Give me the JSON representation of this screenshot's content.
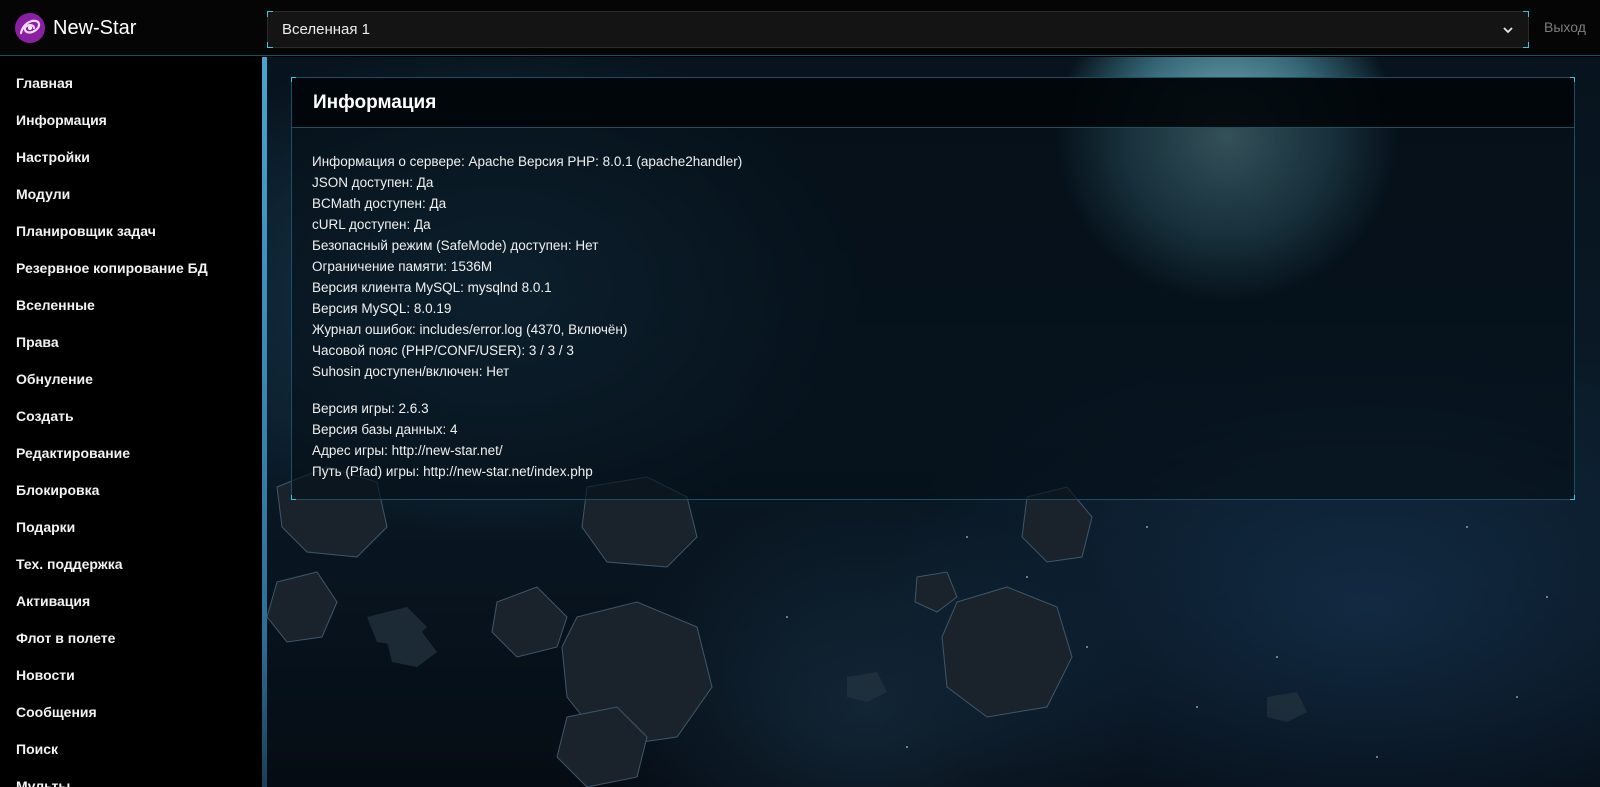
{
  "header": {
    "brand_name": "New-Star",
    "universe_select_value": "Вселенная 1",
    "logout_label": "Выход"
  },
  "sidebar": {
    "items": [
      {
        "label": "Главная"
      },
      {
        "label": "Информация"
      },
      {
        "label": "Настройки"
      },
      {
        "label": "Модули"
      },
      {
        "label": "Планировщик задач"
      },
      {
        "label": "Резервное копирование БД"
      },
      {
        "label": "Вселенные"
      },
      {
        "label": "Права"
      },
      {
        "label": "Обнуление"
      },
      {
        "label": "Создать"
      },
      {
        "label": "Редактирование"
      },
      {
        "label": "Блокировка"
      },
      {
        "label": "Подарки"
      },
      {
        "label": "Тех. поддержка"
      },
      {
        "label": "Активация"
      },
      {
        "label": "Флот в полете"
      },
      {
        "label": "Новости"
      },
      {
        "label": "Сообщения"
      },
      {
        "label": "Поиск"
      },
      {
        "label": "Мульты"
      }
    ]
  },
  "panel": {
    "title": "Информация",
    "server_info": [
      "Информация о сервере: Apache Версия PHP: 8.0.1 (apache2handler)",
      "JSON доступен: Да",
      "BCMath доступен: Да",
      "cURL доступен: Да",
      "Безопасный режим (SafeMode) доступен: Нет",
      "Ограничение памяти: 1536M",
      "Версия клиента MySQL: mysqlnd 8.0.1",
      "Версия MySQL: 8.0.19",
      "Журнал ошибок: includes/error.log (4370, Включён)",
      "Часовой пояс (PHP/CONF/USER): 3 / 3 / 3",
      "Suhosin доступен/включен: Нет"
    ],
    "game_info": [
      "Версия игры: 2.6.3",
      "Версия базы данных: 4",
      "Адрес игры: http://new-star.net/",
      "Путь (Pfad) игры: http://new-star.net/index.php"
    ]
  },
  "colors": {
    "accent": "#35c6e0",
    "logo": "#8b1fa3",
    "sidebar_rail": "#4aa3cf",
    "muted_text": "#7d7d7d"
  }
}
